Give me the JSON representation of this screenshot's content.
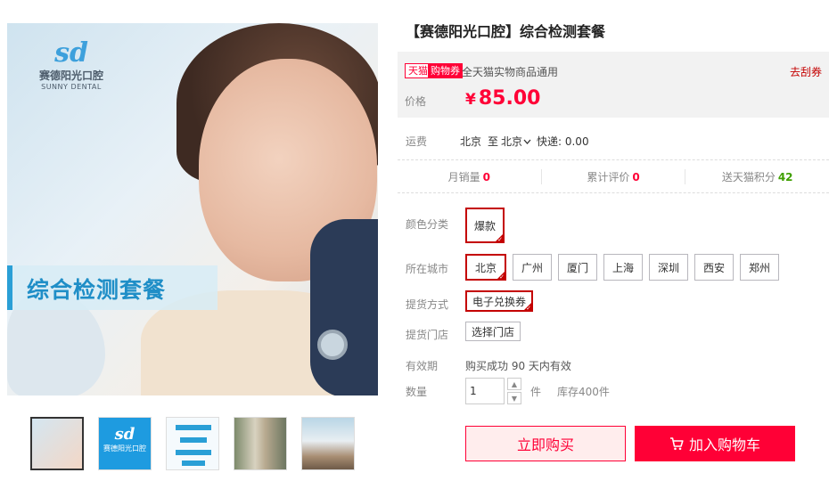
{
  "gallery": {
    "logo_mark": "sd",
    "logo_cn": "赛德阳光口腔",
    "logo_en": "SUNNY DENTAL",
    "banner_text": "综合检测套餐",
    "zoom_icon": "magnifier-icon",
    "thumbs": [
      {
        "name": "thumb-1",
        "active": true
      },
      {
        "name": "thumb-2",
        "mark": "sd",
        "text": "赛德阳光口腔"
      },
      {
        "name": "thumb-3"
      },
      {
        "name": "thumb-4"
      },
      {
        "name": "thumb-5"
      }
    ]
  },
  "product": {
    "title": "【赛德阳光口腔】综合检测套餐",
    "tmall_tag": "天猫",
    "coupon_tag": "购物券",
    "coupon_desc": "全天猫实物商品通用",
    "coupon_link": "去刮券",
    "price_label": "价格",
    "currency": "¥",
    "price": "85.00"
  },
  "shipping": {
    "label": "运费",
    "from": "北京",
    "to_word": "至",
    "to": "北京",
    "express": "快递: 0.00"
  },
  "stats": {
    "monthly_sales_label": "月销量",
    "monthly_sales": "0",
    "reviews_label": "累计评价",
    "reviews": "0",
    "points_label": "送天猫积分",
    "points": "42"
  },
  "options": {
    "color_label": "颜色分类",
    "color_values": [
      "爆款"
    ],
    "city_label": "所在城市",
    "city_values": [
      "北京",
      "广州",
      "厦门",
      "上海",
      "深圳",
      "西安",
      "郑州"
    ],
    "pickup_label": "提货方式",
    "pickup_values": [
      "电子兑换券"
    ],
    "store_label": "提货门店",
    "store_button": "选择门店",
    "validity_label": "有效期",
    "validity_value": "购买成功 90 天内有效",
    "qty_label": "数量",
    "qty_value": "1",
    "qty_unit": "件",
    "stock": "库存400件"
  },
  "actions": {
    "buy_now": "立即购买",
    "add_to_cart": "加入购物车"
  },
  "colors": {
    "accent": "#ff0036",
    "selected_border": "#c40000",
    "points_green": "#3f9f00"
  }
}
